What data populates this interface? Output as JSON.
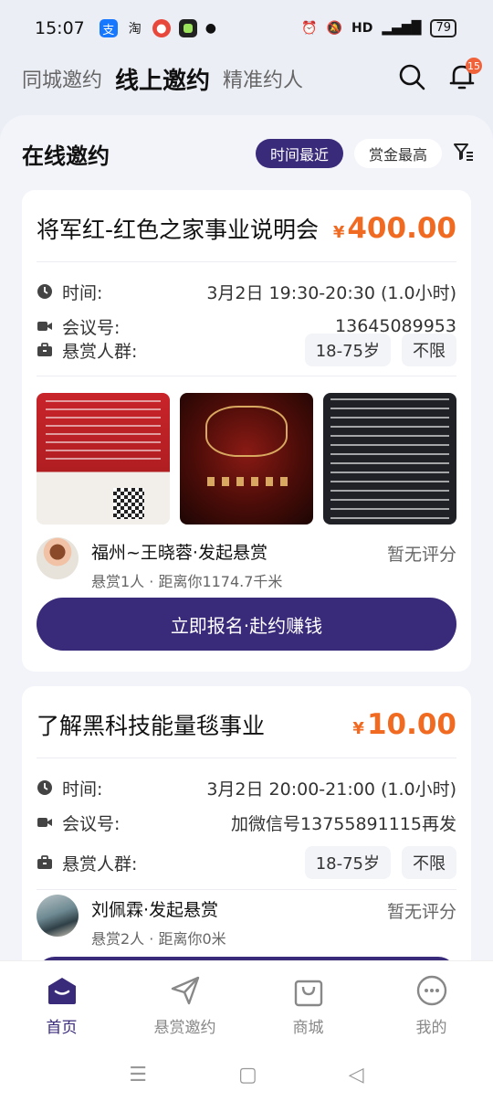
{
  "status": {
    "time": "15:07",
    "battery": "79",
    "net": "HD"
  },
  "tabs": [
    {
      "label": "同城邀约"
    },
    {
      "label": "线上邀约"
    },
    {
      "label": "精准约人"
    }
  ],
  "notification_count": "15",
  "section": {
    "title": "在线邀约",
    "sort_recent": "时间最近",
    "sort_reward": "赏金最高"
  },
  "cards": [
    {
      "title": "将军红-红色之家事业说明会",
      "currency": "¥",
      "price": "400.00",
      "time_label": "时间:",
      "time_value": "3月2日 19:30-20:30 (1.0小时)",
      "meeting_label": "会议号:",
      "meeting_value": "13645089953",
      "crowd_label": "悬赏人群:",
      "crowd_age": "18-75岁",
      "crowd_gender": "不限",
      "initiator_name": "福州~王晓蓉·发起悬赏",
      "initiator_sub": "悬赏1人 · 距离你1174.7千米",
      "rating": "暂无评分",
      "cta": "立即报名·赴约赚钱"
    },
    {
      "title": "了解黑科技能量毯事业",
      "currency": "¥",
      "price": "10.00",
      "time_label": "时间:",
      "time_value": "3月2日 20:00-21:00 (1.0小时)",
      "meeting_label": "会议号:",
      "meeting_value": "加微信号13755891115再发",
      "crowd_label": "悬赏人群:",
      "crowd_age": "18-75岁",
      "crowd_gender": "不限",
      "initiator_name": "刘佩霖·发起悬赏",
      "initiator_sub": "悬赏2人 · 距离你0米",
      "rating": "暂无评分"
    }
  ],
  "nav": [
    {
      "label": "首页"
    },
    {
      "label": "悬赏邀约"
    },
    {
      "label": "商城"
    },
    {
      "label": "我的"
    }
  ],
  "colors": {
    "primary": "#3a2a7a",
    "price": "#f16a22",
    "badge": "#f0623a"
  }
}
